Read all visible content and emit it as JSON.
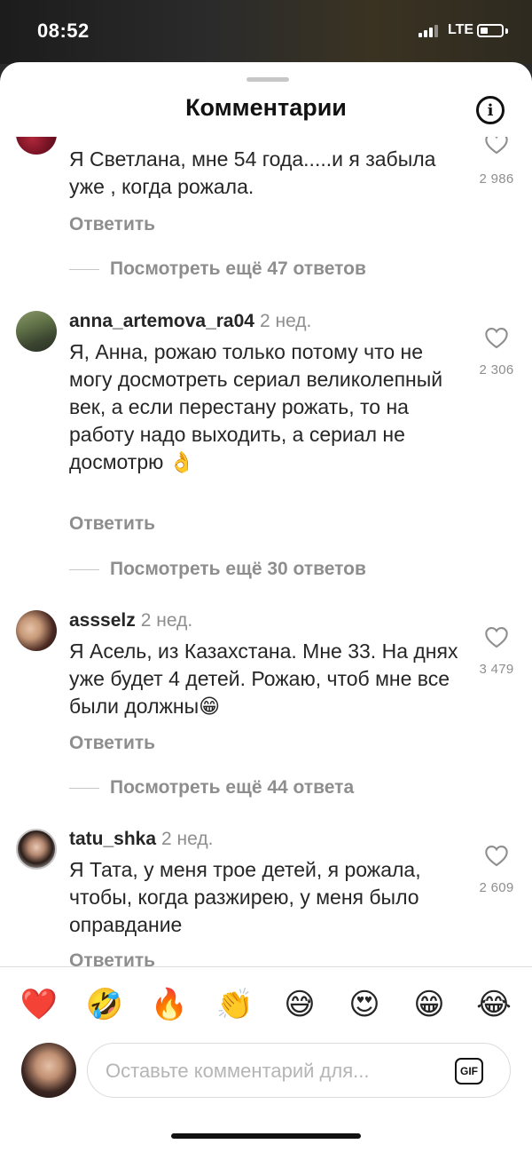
{
  "status_bar": {
    "time": "08:52",
    "network": "LTE"
  },
  "header": {
    "title": "Комментарии"
  },
  "comments": [
    {
      "username": "",
      "time": "",
      "text": "Я Светлана, мне 54 года.....и я забыла уже , когда рожала.",
      "likes": "2 986",
      "reply_label": "Ответить",
      "more_replies": "Посмотреть ещё 47 ответов"
    },
    {
      "username": "anna_artemova_ra04",
      "time": "2 нед.",
      "text": "Я, Анна, рожаю только потому что не могу досмотреть сериал великолепный век, а если перестану рожать, то на работу надо выходить, а сериал не досмотрю   👌",
      "likes": "2 306",
      "reply_label": "Ответить",
      "more_replies": "Посмотреть ещё 30 ответов"
    },
    {
      "username": "assselz",
      "time": "2 нед.",
      "text": "Я Асель, из Казахстана. Мне 33. На днях уже будет 4 детей. Рожаю, чтоб мне все были должны😁",
      "likes": "3 479",
      "reply_label": "Ответить",
      "more_replies": "Посмотреть ещё 44 ответа"
    },
    {
      "username": "tatu_shka",
      "time": "2 нед.",
      "text": "Я Тата, у меня трое детей, я рожала, чтобы, когда разжирею, у меня было оправдание",
      "likes": "2 609",
      "reply_label": "Ответить",
      "more_replies": ""
    }
  ],
  "emoji_bar": [
    "❤️",
    "🤣",
    "🔥",
    "👏",
    "😅",
    "😍",
    "😁",
    "😂"
  ],
  "composer": {
    "placeholder": "Оставьте комментарий для...",
    "gif_label": "GIF"
  }
}
